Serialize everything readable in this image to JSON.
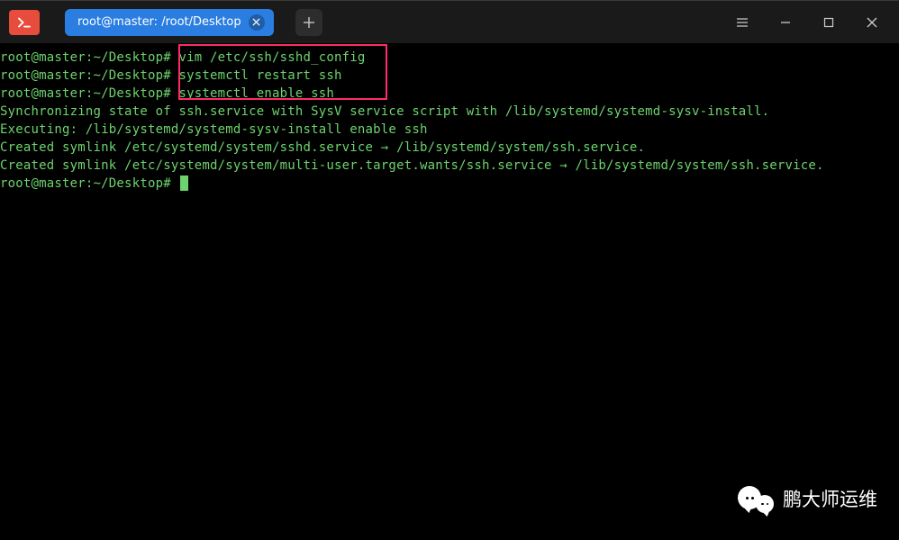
{
  "window": {
    "tab_title": "root@master: /root/Desktop"
  },
  "terminal": {
    "prompt": "root@master:~/Desktop#",
    "lines": [
      {
        "type": "cmd",
        "text": "vim /etc/ssh/sshd_config"
      },
      {
        "type": "cmd",
        "text": "systemctl restart ssh"
      },
      {
        "type": "cmd",
        "text": "systemctl enable ssh"
      },
      {
        "type": "out",
        "text": "Synchronizing state of ssh.service with SysV service script with /lib/systemd/systemd-sysv-install."
      },
      {
        "type": "out",
        "text": "Executing: /lib/systemd/systemd-sysv-install enable ssh"
      },
      {
        "type": "out",
        "text": "Created symlink /etc/systemd/system/sshd.service → /lib/systemd/system/ssh.service."
      },
      {
        "type": "out",
        "text": "Created symlink /etc/systemd/system/multi-user.target.wants/ssh.service → /lib/systemd/system/ssh.service."
      },
      {
        "type": "prompt_only"
      }
    ]
  },
  "watermark": {
    "text": "鹏大师运维"
  }
}
